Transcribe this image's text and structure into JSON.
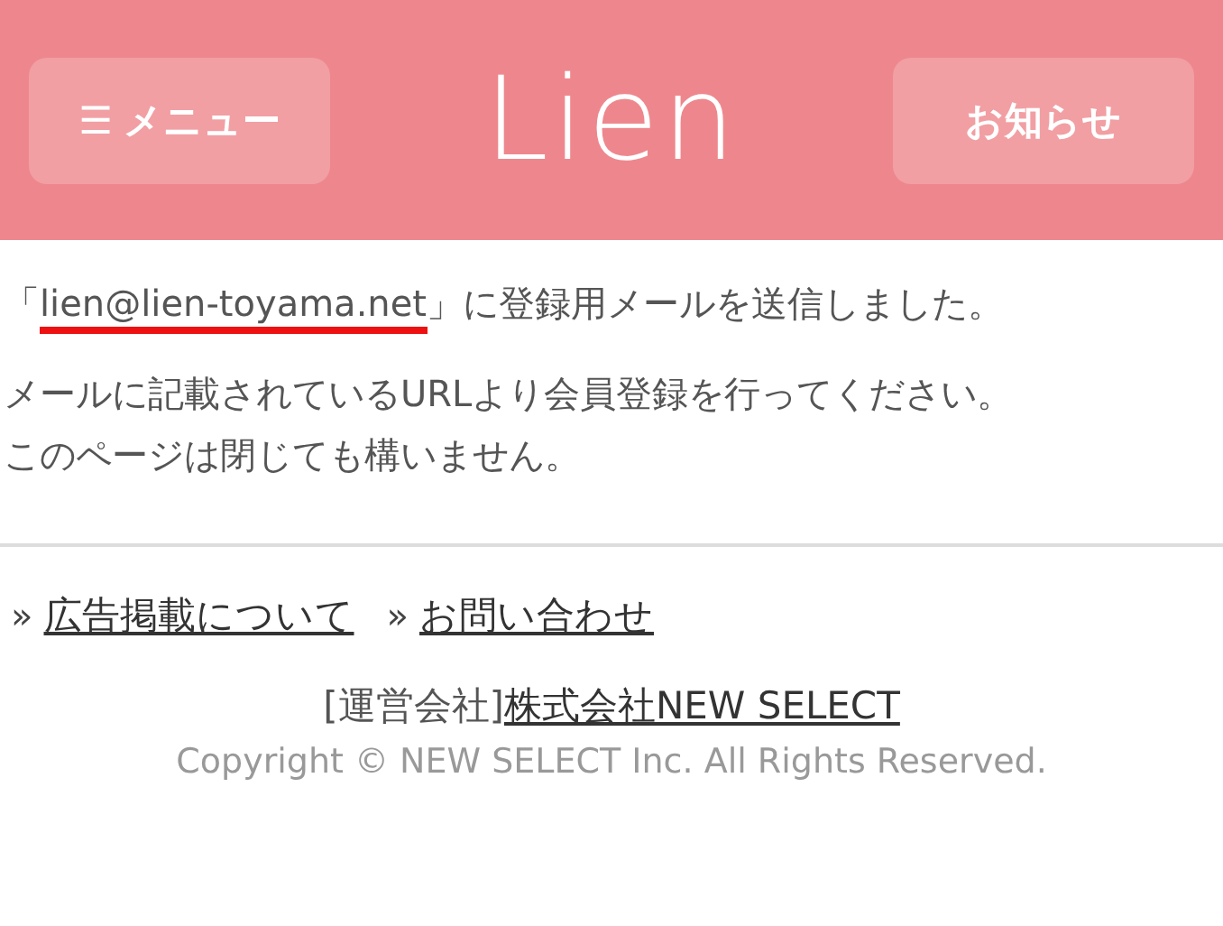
{
  "header": {
    "menu_button": {
      "icon": "☰",
      "label": "メニュー"
    },
    "logo": "Lien",
    "news_button": "お知らせ"
  },
  "message": {
    "prefix": "「",
    "email": "lien@lien-toyama.net",
    "suffix": "」に登録用メールを送信しました。",
    "highlighted": true
  },
  "instructions": [
    "メールに記載されているURLより会員登録を行ってください。",
    "このページは閉じても構いません。"
  ],
  "footer_links": [
    {
      "marker": "»",
      "label": "広告掲載について"
    },
    {
      "marker": "»",
      "label": "お問い合わせ"
    }
  ],
  "operator": {
    "label": "[運営会社]",
    "company": "株式会社NEW SELECT"
  },
  "copyright": "Copyright © NEW SELECT Inc. All Rights Reserved."
}
